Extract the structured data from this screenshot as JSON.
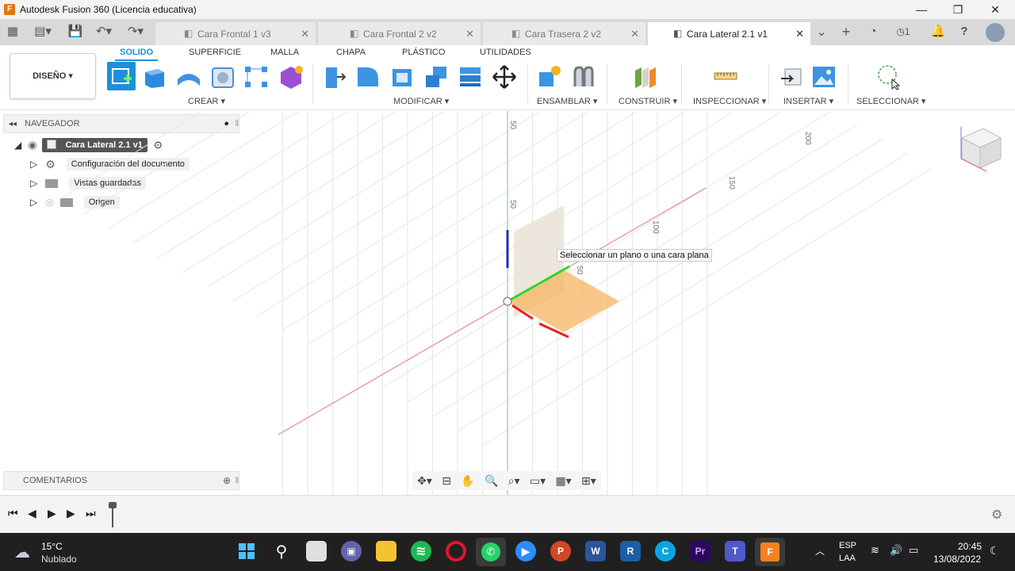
{
  "window": {
    "title": "Autodesk Fusion 360 (Licencia educativa)",
    "app_icon": "F"
  },
  "tabs": [
    {
      "label": "Cara Frontal 1 v3",
      "active": false
    },
    {
      "label": "Cara Frontal 2 v2",
      "active": false
    },
    {
      "label": "Cara Trasera 2 v2",
      "active": false
    },
    {
      "label": "Cara Lateral 2.1 v1",
      "active": true
    }
  ],
  "tabbar": {
    "job_count": "1"
  },
  "ribbon": {
    "workspace": "DISEÑO ▾",
    "tabs": [
      "SOLIDO",
      "SUPERFICIE",
      "MALLA",
      "CHAPA",
      "PLÁSTICO",
      "UTILIDADES"
    ],
    "groups": [
      "CREAR ▾",
      "MODIFICAR ▾",
      "ENSAMBLAR ▾",
      "CONSTRUIR ▾",
      "INSPECCIONAR ▾",
      "INSERTAR ▾",
      "SELECCIONAR ▾"
    ]
  },
  "browser": {
    "header": "NAVEGADOR",
    "root": "Cara Lateral 2.1 v1",
    "items": [
      "Configuración del documento",
      "Vistas guardadas",
      "Origen"
    ]
  },
  "comments": {
    "header": "COMENTARIOS"
  },
  "viewport": {
    "tooltip": "Seleccionar un plano o una cara plana",
    "grid_labels": [
      "50",
      "50",
      "50",
      "100",
      "150",
      "200"
    ]
  },
  "taskbar": {
    "weather_temp": "15°C",
    "weather_desc": "Nublado",
    "lang1": "ESP",
    "lang2": "LAA",
    "time": "20:45",
    "date": "13/08/2022"
  }
}
